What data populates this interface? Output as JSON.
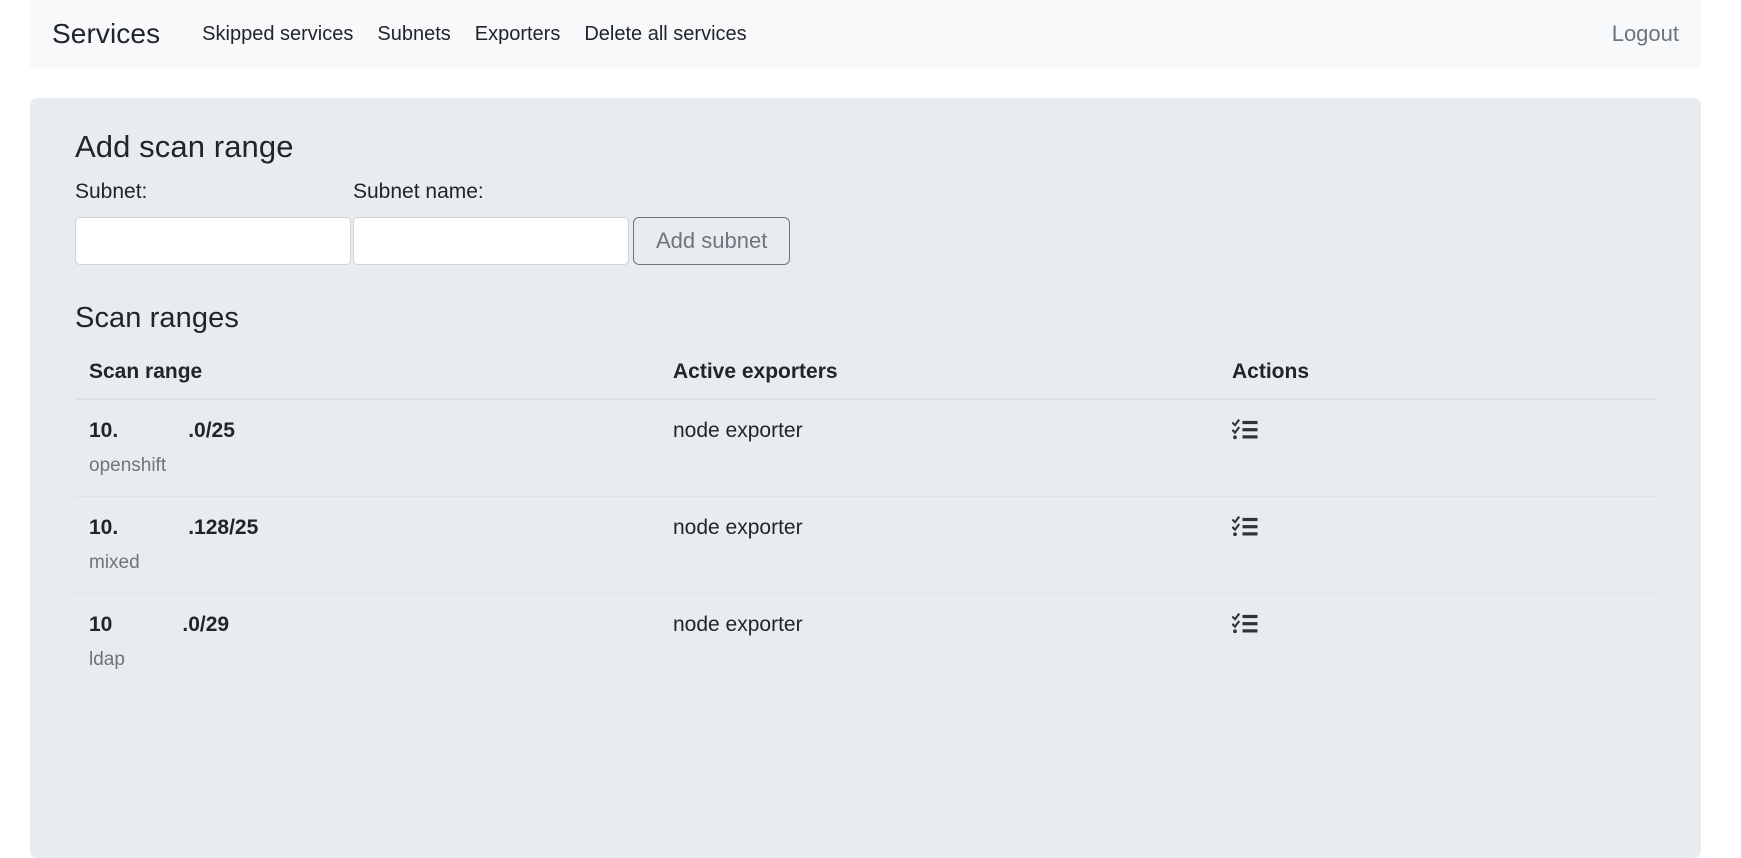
{
  "navbar": {
    "brand": "Services",
    "links": [
      {
        "label": "Skipped services",
        "name": "nav-link-skipped-services"
      },
      {
        "label": "Subnets",
        "name": "nav-link-subnets"
      },
      {
        "label": "Exporters",
        "name": "nav-link-exporters"
      },
      {
        "label": "Delete all services",
        "name": "nav-link-delete-all-services"
      }
    ],
    "logout": "Logout"
  },
  "add_scan_range": {
    "title": "Add scan range",
    "subnet_label": "Subnet:",
    "subnet_name_label": "Subnet name:",
    "subnet_value": "",
    "subnet_placeholder": "",
    "subnet_name_value": "",
    "subnet_name_placeholder": "",
    "add_button": "Add subnet"
  },
  "scan_ranges": {
    "title": "Scan ranges",
    "columns": {
      "range": "Scan range",
      "exporters": "Active exporters",
      "actions": "Actions"
    },
    "rows": [
      {
        "range": "10.            .0/25",
        "name": "openshift",
        "exporters": "node exporter",
        "action_icon": "task-list-icon"
      },
      {
        "range": "10.            .128/25",
        "name": "mixed",
        "exporters": "node exporter",
        "action_icon": "task-list-icon"
      },
      {
        "range": "10            .0/29",
        "name": "ldap",
        "exporters": "node exporter",
        "action_icon": "task-list-icon"
      }
    ]
  },
  "colors": {
    "page_background": "#ffffff",
    "navbar_background": "#f8f9fa",
    "card_background": "#e9ecef",
    "text": "#212529",
    "muted_text": "#6c757d",
    "border": "#dee2e6",
    "input_border": "#ced4da"
  }
}
